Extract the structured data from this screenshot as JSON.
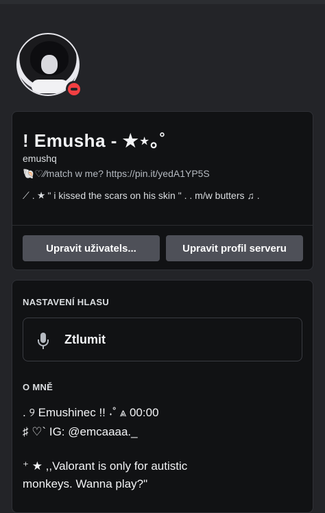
{
  "profile": {
    "display_name": "!  Emusha - ★⋆｡˚",
    "username": "emushq",
    "pronouns": "🐚♡⁄⁄match w me? https://pin.it/yedA1YP5S",
    "bio": "⟋ . ★ \" i kissed the scars on his skin \" . . m/w butters ♫ ."
  },
  "buttons": {
    "edit_user": "Upravit uživatels...",
    "edit_server_profile": "Upravit profil serveru"
  },
  "voice_settings": {
    "title": "NASTAVENÍ HLASU",
    "mute_label": "Ztlumit"
  },
  "about": {
    "title": "O MNĚ",
    "line1": ".   ୨   Emushinec !! ˖˚ ⩓ 00:00",
    "line2": "   ♯    ♡`   IG: @emcaaaa._",
    "line3": "⁺      ★ ,,Valorant is only for autistic",
    "line4": "          monkeys. Wanna play?\""
  },
  "colors": {
    "background": "#232428",
    "card": "#111214",
    "button": "#4e5058",
    "dnd_status": "#f23f42"
  },
  "icons": [
    "status-dnd-icon",
    "microphone-icon"
  ]
}
